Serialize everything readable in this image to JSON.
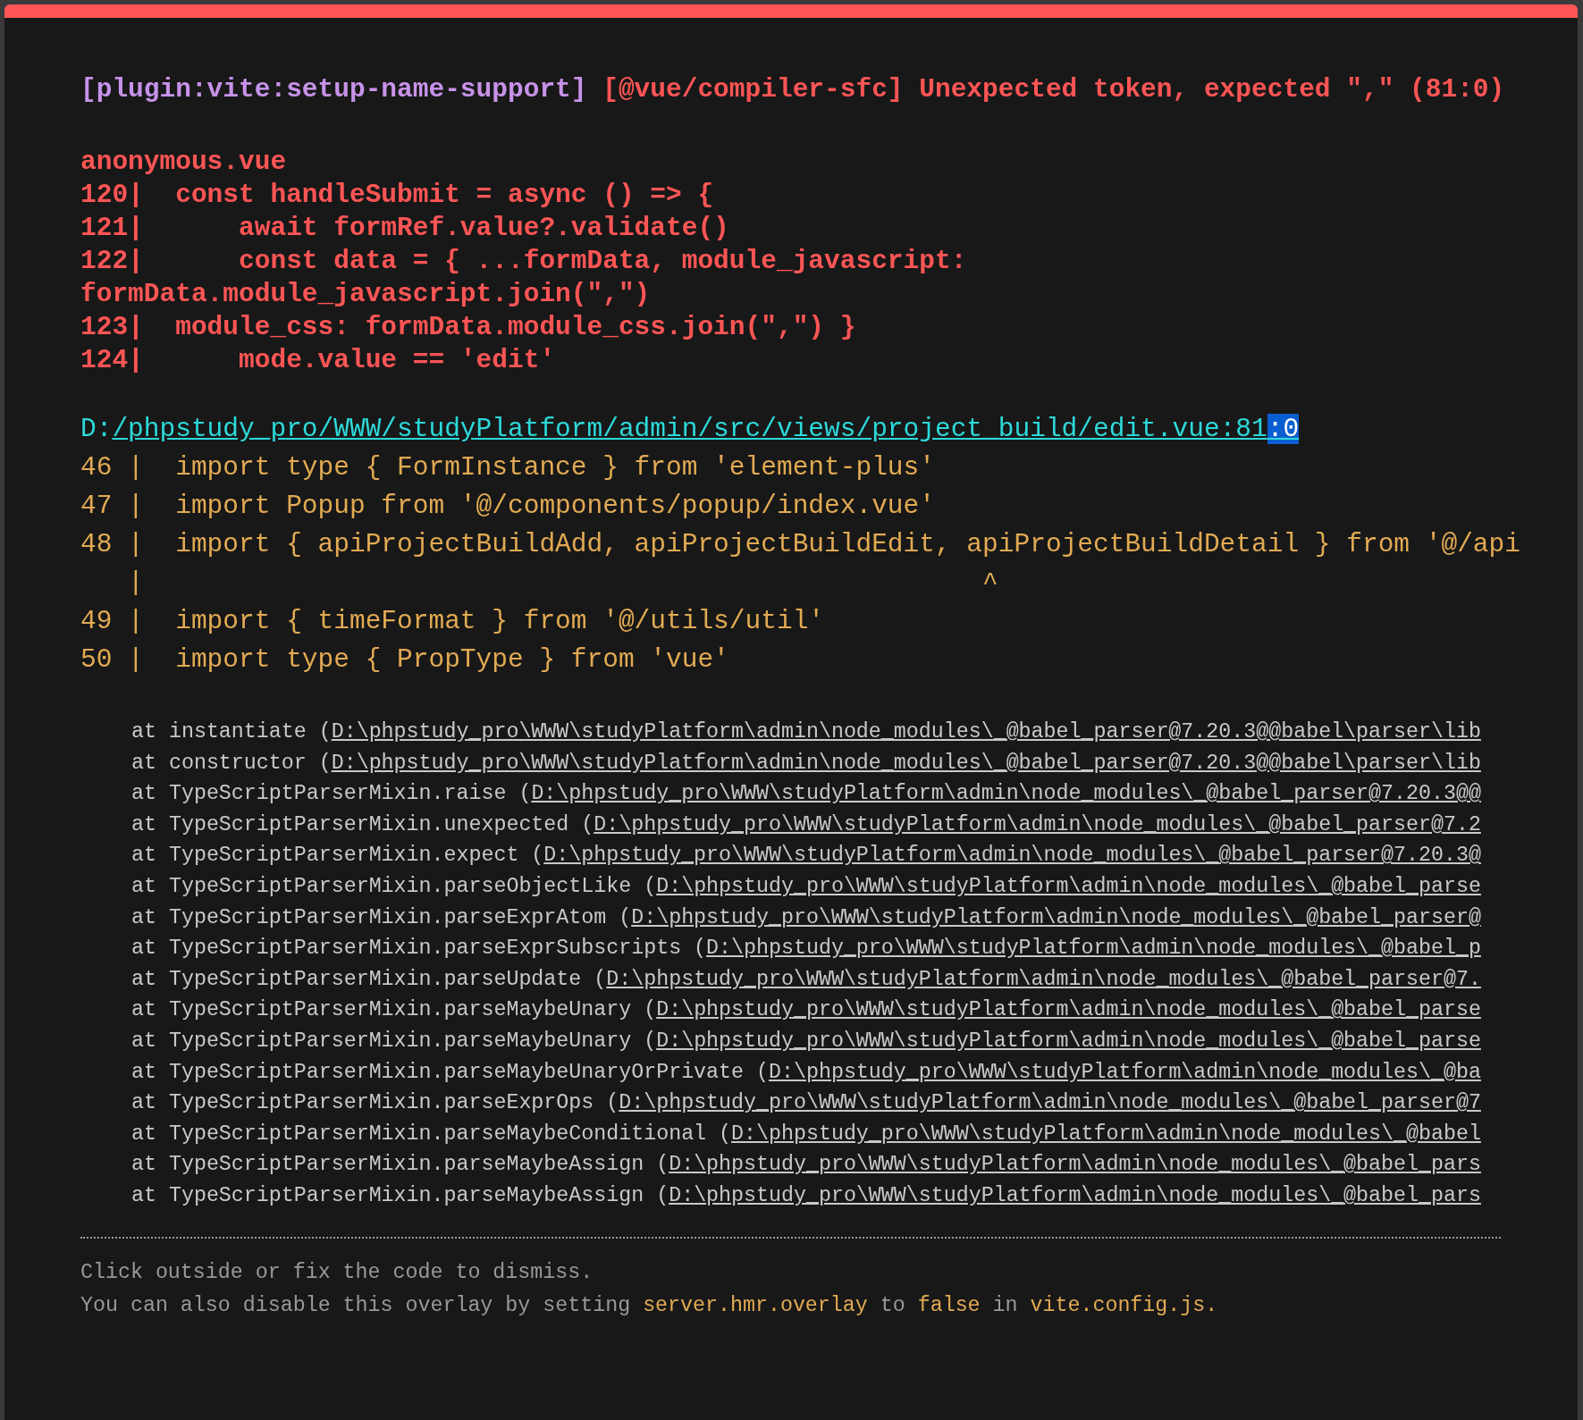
{
  "message": {
    "plugin": "[plugin:vite:setup-name-support]",
    "text": "[@vue/compiler-sfc] Unexpected token, expected \",\" (81:0)"
  },
  "source": {
    "file": "anonymous.vue",
    "lines": [
      {
        "text": "120|  const handleSubmit = async () => {"
      },
      {
        "text": "121|      await formRef.value?.validate()"
      },
      {
        "text": "122|      const data = { ...formData, module_javascript:"
      },
      {
        "text": "formData.module_javascript.join(\",\")"
      },
      {
        "text": "123|  module_css: formData.module_css.join(\",\") }"
      },
      {
        "text": "124|      mode.value == 'edit'"
      }
    ]
  },
  "location": {
    "prefix": "D:",
    "link": "/phpstudy_pro/WWW/studyPlatform/admin/src/views/project_build/edit.vue:81",
    "selected_text": ":0"
  },
  "frame": [
    {
      "text": "46 |  import type { FormInstance } from 'element-plus'"
    },
    {
      "text": "47 |  import Popup from '@/components/popup/index.vue'"
    },
    {
      "text": "48 |  import { apiProjectBuildAdd, apiProjectBuildEdit, apiProjectBuildDetail } from '@/api"
    },
    {
      "text": "   |                                                     ^"
    },
    {
      "text": "49 |  import { timeFormat } from '@/utils/util'"
    },
    {
      "text": "50 |  import type { PropType } from 'vue'"
    }
  ],
  "stack": [
    {
      "call": "at instantiate (",
      "path": "D:\\phpstudy_pro\\WWW\\studyPlatform\\admin\\node_modules\\_@babel_parser@7.20.3@@babel\\parser\\lib"
    },
    {
      "call": "at constructor (",
      "path": "D:\\phpstudy_pro\\WWW\\studyPlatform\\admin\\node_modules\\_@babel_parser@7.20.3@@babel\\parser\\lib"
    },
    {
      "call": "at TypeScriptParserMixin.raise (",
      "path": "D:\\phpstudy_pro\\WWW\\studyPlatform\\admin\\node_modules\\_@babel_parser@7.20.3@@"
    },
    {
      "call": "at TypeScriptParserMixin.unexpected (",
      "path": "D:\\phpstudy_pro\\WWW\\studyPlatform\\admin\\node_modules\\_@babel_parser@7.2"
    },
    {
      "call": "at TypeScriptParserMixin.expect (",
      "path": "D:\\phpstudy_pro\\WWW\\studyPlatform\\admin\\node_modules\\_@babel_parser@7.20.3@"
    },
    {
      "call": "at TypeScriptParserMixin.parseObjectLike (",
      "path": "D:\\phpstudy_pro\\WWW\\studyPlatform\\admin\\node_modules\\_@babel_parse"
    },
    {
      "call": "at TypeScriptParserMixin.parseExprAtom (",
      "path": "D:\\phpstudy_pro\\WWW\\studyPlatform\\admin\\node_modules\\_@babel_parser@"
    },
    {
      "call": "at TypeScriptParserMixin.parseExprSubscripts (",
      "path": "D:\\phpstudy_pro\\WWW\\studyPlatform\\admin\\node_modules\\_@babel_p"
    },
    {
      "call": "at TypeScriptParserMixin.parseUpdate (",
      "path": "D:\\phpstudy_pro\\WWW\\studyPlatform\\admin\\node_modules\\_@babel_parser@7."
    },
    {
      "call": "at TypeScriptParserMixin.parseMaybeUnary (",
      "path": "D:\\phpstudy_pro\\WWW\\studyPlatform\\admin\\node_modules\\_@babel_parse"
    },
    {
      "call": "at TypeScriptParserMixin.parseMaybeUnary (",
      "path": "D:\\phpstudy_pro\\WWW\\studyPlatform\\admin\\node_modules\\_@babel_parse"
    },
    {
      "call": "at TypeScriptParserMixin.parseMaybeUnaryOrPrivate (",
      "path": "D:\\phpstudy_pro\\WWW\\studyPlatform\\admin\\node_modules\\_@ba"
    },
    {
      "call": "at TypeScriptParserMixin.parseExprOps (",
      "path": "D:\\phpstudy_pro\\WWW\\studyPlatform\\admin\\node_modules\\_@babel_parser@7"
    },
    {
      "call": "at TypeScriptParserMixin.parseMaybeConditional (",
      "path": "D:\\phpstudy_pro\\WWW\\studyPlatform\\admin\\node_modules\\_@babel"
    },
    {
      "call": "at TypeScriptParserMixin.parseMaybeAssign (",
      "path": "D:\\phpstudy_pro\\WWW\\studyPlatform\\admin\\node_modules\\_@babel_pars"
    },
    {
      "call": "at TypeScriptParserMixin.parseMaybeAssign (",
      "path": "D:\\phpstudy_pro\\WWW\\studyPlatform\\admin\\node_modules\\_@babel_pars"
    }
  ],
  "tips": [
    {
      "parts": [
        {
          "kind": "plain",
          "text": "Click outside or fix the code to dismiss."
        }
      ]
    },
    {
      "parts": [
        {
          "kind": "plain",
          "text": "You can also disable this overlay by setting "
        },
        {
          "kind": "code",
          "text": "server.hmr.overlay"
        },
        {
          "kind": "plain",
          "text": " to "
        },
        {
          "kind": "code",
          "text": "false"
        },
        {
          "kind": "plain",
          "text": " in "
        },
        {
          "kind": "code",
          "text": "vite.config.js."
        }
      ]
    }
  ]
}
